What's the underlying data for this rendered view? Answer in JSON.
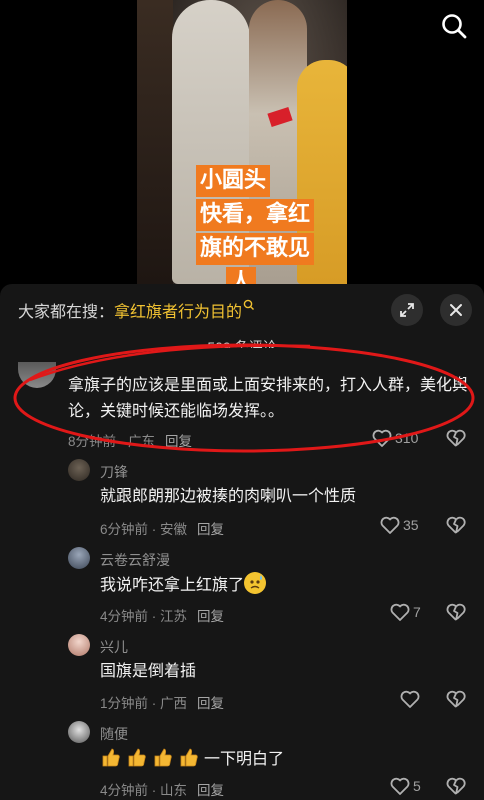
{
  "video": {
    "caption_lines": [
      "小圆头",
      "快看，拿红",
      "旗的不敢见",
      "人"
    ]
  },
  "sheet": {
    "search_prefix": "大家都在搜：",
    "search_keyword": "拿红旗者行为目的",
    "comment_count": "509 条评论"
  },
  "comments": [
    {
      "user": "",
      "text": "拿旗子的应该是里面或上面安排来的，打入人群，美化舆论，关键时候还能临场发挥。。",
      "time": "8分钟前",
      "location": "广东",
      "reply_label": "回复",
      "likes": "310"
    },
    {
      "user": "刀锋",
      "text": "就跟郎朗那边被揍的肉喇叭一个性质",
      "time": "6分钟前",
      "location": "安徽",
      "reply_label": "回复",
      "likes": "35"
    },
    {
      "user": "云卷云舒漫",
      "text": "我说咋还拿上红旗了",
      "time": "4分钟前",
      "location": "江苏",
      "reply_label": "回复",
      "likes": "7"
    },
    {
      "user": "兴儿",
      "text": "国旗是倒着插",
      "time": "1分钟前",
      "location": "广西",
      "reply_label": "回复",
      "likes": ""
    },
    {
      "user": "随便",
      "text": "一下明白了",
      "time": "4分钟前",
      "location": "山东",
      "reply_label": "回复",
      "likes": "5"
    }
  ],
  "colors": {
    "caption_bg": "#f07a1f",
    "keyword": "#f1c232",
    "annotation": "#e01818",
    "sheet_bg": "#161616"
  },
  "icons": [
    "search-icon",
    "expand-icon",
    "close-icon",
    "heart-icon",
    "broken-heart-icon",
    "thumbs-up-emoji",
    "sweat-emoji"
  ]
}
